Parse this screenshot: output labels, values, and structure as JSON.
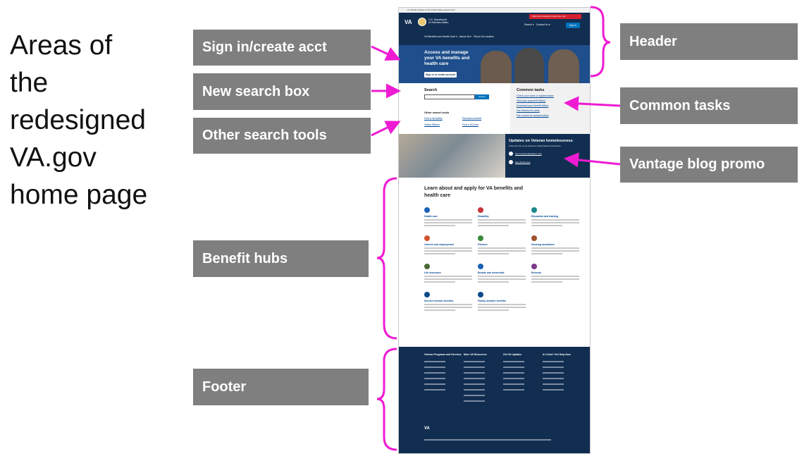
{
  "slide": {
    "title_lines": [
      "Areas of",
      "the",
      "redesigned",
      "VA.gov",
      "home page"
    ]
  },
  "callouts": {
    "sign_in": "Sign in/create acct",
    "search_box": "New search box",
    "search_tools": "Other search tools",
    "header": "Header",
    "common_tasks": "Common tasks",
    "vantage": "Vantage blog promo",
    "benefit_hubs": "Benefit hubs",
    "footer": "Footer"
  },
  "colors": {
    "callout_bg": "#7f7f7f",
    "arrow": "#ee1bd3",
    "va_navy": "#112e51",
    "va_blue": "#0071bb"
  },
  "mock": {
    "logo": "VA",
    "dept_lines": [
      "U.S. Department",
      "of Veterans Affairs"
    ],
    "hero_title": "Access and manage your VA benefits and health care",
    "hero_button": "Sign in or create account",
    "sign_in": "Sign in",
    "search_heading": "Search",
    "search_button": "Search",
    "other_tools_heading": "Other search tools",
    "search_links": [
      "Find a VA facility",
      "Education benefit",
      "Yellow Ribbon",
      "Find a VA form"
    ],
    "tasks_heading": "Common tasks",
    "tasks": [
      "Check your claim or appeal status",
      "View your payment history",
      "Download your benefit letters",
      "Get Veteran ID cards",
      "File a claim for compensation"
    ],
    "promo_heading": "Updates on Veteran homelessness",
    "benefits_heading": "Learn about and apply for VA benefits and health care",
    "hubs": [
      {
        "label": "Health care",
        "color": "#1a63b4"
      },
      {
        "label": "Disability",
        "color": "#c7343a"
      },
      {
        "label": "Education and training",
        "color": "#1a8a8a"
      },
      {
        "label": "Careers and employment",
        "color": "#d0532b"
      },
      {
        "label": "Pension",
        "color": "#3b8a3b"
      },
      {
        "label": "Housing assistance",
        "color": "#a0522d"
      },
      {
        "label": "Life insurance",
        "color": "#4a6a34"
      },
      {
        "label": "Burials and memorials",
        "color": "#1a63b4"
      },
      {
        "label": "Records",
        "color": "#7b3a8a"
      },
      {
        "label": "Service member benefits",
        "color": "#0b4a8a"
      },
      {
        "label": "Family member benefits",
        "color": "#0b4a8a"
      }
    ],
    "footer_headings": [
      "Veteran Programs and Services",
      "More VA Resources",
      "Get VA Updates",
      "In Crisis? Get Help Now"
    ]
  }
}
